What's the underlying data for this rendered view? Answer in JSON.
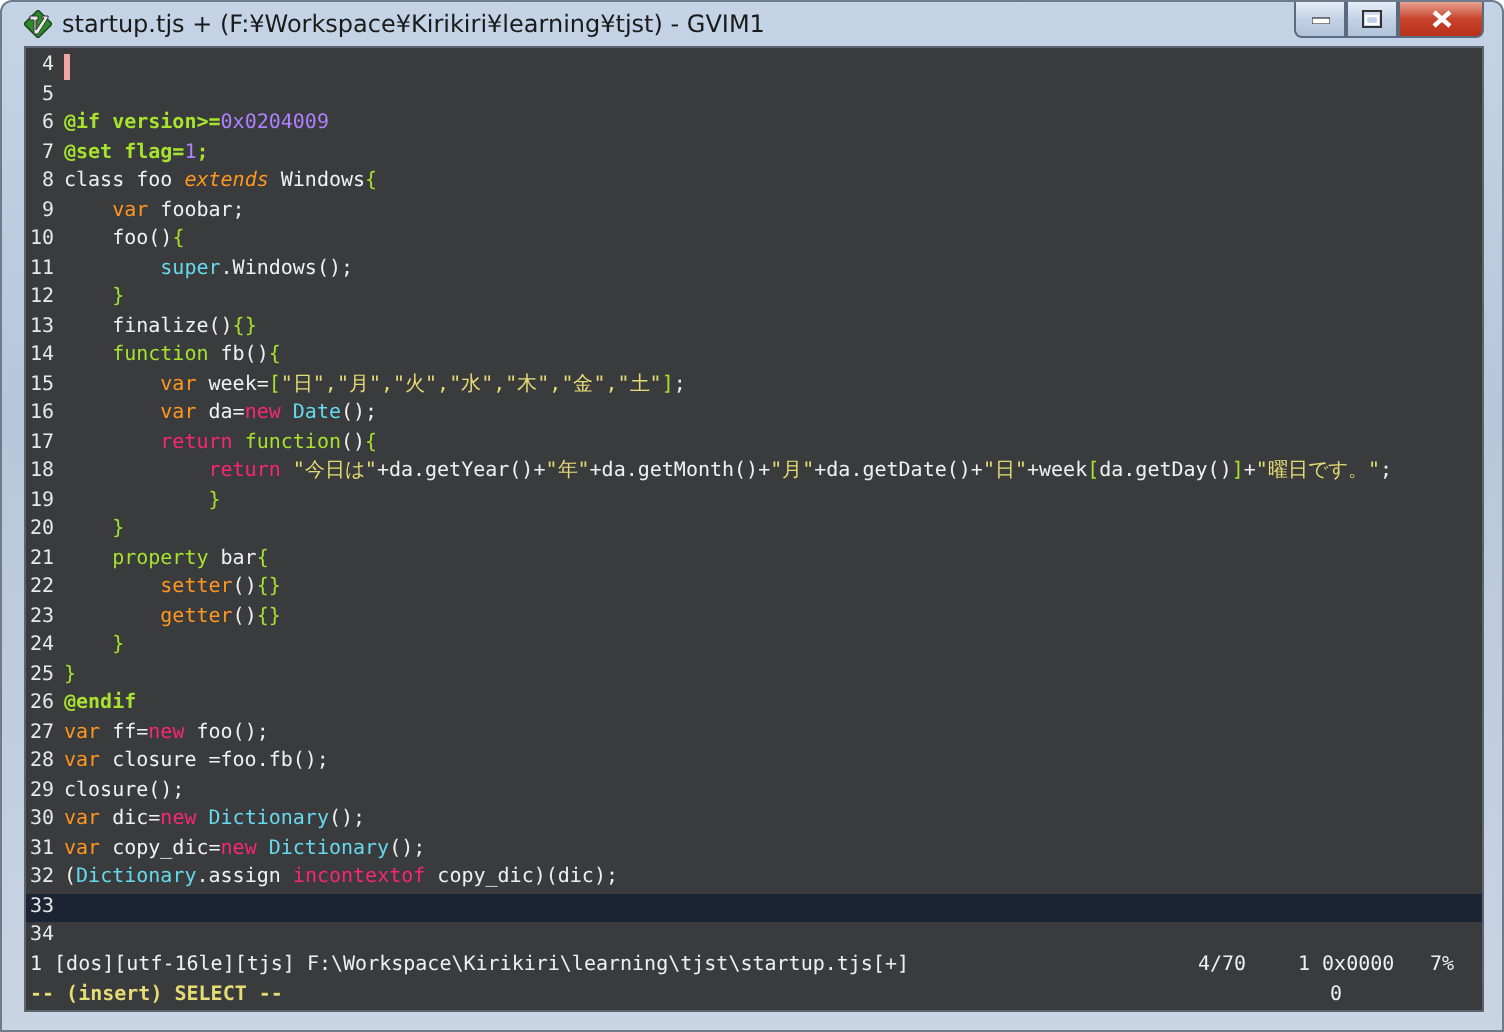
{
  "window": {
    "title": "startup.tjs + (F:¥Workspace¥Kirikiri¥learning¥tjst) - GVIM1"
  },
  "lines": [
    {
      "number": "4",
      "cursor": true,
      "highlighted": false
    },
    {
      "number": "5",
      "cursor": false,
      "highlighted": false
    },
    {
      "number": "6",
      "cursor": false,
      "highlighted": false,
      "segments": [
        {
          "text": "@if version>=",
          "kind": "directive"
        },
        {
          "text": "0x0204009",
          "kind": "number"
        }
      ]
    },
    {
      "number": "7",
      "cursor": false,
      "highlighted": false,
      "segments": [
        {
          "text": "@set flag=",
          "kind": "directive"
        },
        {
          "text": "1",
          "kind": "number"
        },
        {
          "text": ";",
          "kind": "directive"
        }
      ]
    },
    {
      "number": "8",
      "cursor": false,
      "highlighted": false,
      "segments": [
        {
          "text": "class foo ",
          "kind": "plain"
        },
        {
          "text": "extends",
          "kind": "modifier"
        },
        {
          "text": " Windows",
          "kind": "plain"
        },
        {
          "text": "{",
          "kind": "brace"
        }
      ]
    },
    {
      "number": "9",
      "cursor": false,
      "highlighted": false,
      "segments": [
        {
          "text": "    var",
          "kind": "keyword"
        },
        {
          "text": " foobar;",
          "kind": "plain"
        }
      ]
    },
    {
      "number": "10",
      "cursor": false,
      "highlighted": false,
      "segments": [
        {
          "text": "    foo()",
          "kind": "plain"
        },
        {
          "text": "{",
          "kind": "brace"
        }
      ]
    },
    {
      "number": "11",
      "cursor": false,
      "highlighted": false,
      "segments": [
        {
          "text": "        super",
          "kind": "type"
        },
        {
          "text": ".Windows();",
          "kind": "plain"
        }
      ]
    },
    {
      "number": "12",
      "cursor": false,
      "highlighted": false,
      "segments": [
        {
          "text": "    }",
          "kind": "brace"
        }
      ]
    },
    {
      "number": "13",
      "cursor": false,
      "highlighted": false,
      "segments": [
        {
          "text": "    finalize()",
          "kind": "plain"
        },
        {
          "text": "{}",
          "kind": "brace"
        }
      ]
    },
    {
      "number": "14",
      "cursor": false,
      "highlighted": false,
      "segments": [
        {
          "text": "    function",
          "kind": "declaration"
        },
        {
          "text": " fb()",
          "kind": "plain"
        },
        {
          "text": "{",
          "kind": "brace"
        }
      ]
    },
    {
      "number": "15",
      "cursor": false,
      "highlighted": false,
      "segments": [
        {
          "text": "        var",
          "kind": "keyword"
        },
        {
          "text": " week=",
          "kind": "plain"
        },
        {
          "text": "[",
          "kind": "brace"
        },
        {
          "text": "\"日\",\"月\",\"火\",\"水\",\"木\",\"金\",\"土\"",
          "kind": "string"
        },
        {
          "text": "]",
          "kind": "brace"
        },
        {
          "text": ";",
          "kind": "plain"
        }
      ]
    },
    {
      "number": "16",
      "cursor": false,
      "highlighted": false,
      "segments": [
        {
          "text": "        var",
          "kind": "keyword"
        },
        {
          "text": " da=",
          "kind": "plain"
        },
        {
          "text": "new",
          "kind": "operator"
        },
        {
          "text": " Date",
          "kind": "type"
        },
        {
          "text": "();",
          "kind": "plain"
        }
      ]
    },
    {
      "number": "17",
      "cursor": false,
      "highlighted": false,
      "segments": [
        {
          "text": "        return",
          "kind": "operator"
        },
        {
          "text": " function",
          "kind": "declaration"
        },
        {
          "text": "()",
          "kind": "plain"
        },
        {
          "text": "{",
          "kind": "brace"
        }
      ]
    },
    {
      "number": "18",
      "cursor": false,
      "highlighted": false,
      "segments": [
        {
          "text": "            return",
          "kind": "operator"
        },
        {
          "text": " \"今日は\"",
          "kind": "string"
        },
        {
          "text": "+da.getYear()+",
          "kind": "plain"
        },
        {
          "text": "\"年\"",
          "kind": "string"
        },
        {
          "text": "+da.getMonth()+",
          "kind": "plain"
        },
        {
          "text": "\"月\"",
          "kind": "string"
        },
        {
          "text": "+da.getDate()+",
          "kind": "plain"
        },
        {
          "text": "\"日\"",
          "kind": "string"
        },
        {
          "text": "+week",
          "kind": "plain"
        },
        {
          "text": "[",
          "kind": "brace"
        },
        {
          "text": "da.getDay()",
          "kind": "plain"
        },
        {
          "text": "]",
          "kind": "brace"
        },
        {
          "text": "+",
          "kind": "plain"
        },
        {
          "text": "\"曜日です。\"",
          "kind": "string"
        },
        {
          "text": ";",
          "kind": "plain"
        }
      ]
    },
    {
      "number": "19",
      "cursor": false,
      "highlighted": false,
      "segments": [
        {
          "text": "            }",
          "kind": "brace"
        }
      ]
    },
    {
      "number": "20",
      "cursor": false,
      "highlighted": false,
      "segments": [
        {
          "text": "    }",
          "kind": "brace"
        }
      ]
    },
    {
      "number": "21",
      "cursor": false,
      "highlighted": false,
      "segments": [
        {
          "text": "    property",
          "kind": "declaration"
        },
        {
          "text": " bar",
          "kind": "plain"
        },
        {
          "text": "{",
          "kind": "brace"
        }
      ]
    },
    {
      "number": "22",
      "cursor": false,
      "highlighted": false,
      "segments": [
        {
          "text": "        setter",
          "kind": "keyword"
        },
        {
          "text": "()",
          "kind": "plain"
        },
        {
          "text": "{}",
          "kind": "brace"
        }
      ]
    },
    {
      "number": "23",
      "cursor": false,
      "highlighted": false,
      "segments": [
        {
          "text": "        getter",
          "kind": "keyword"
        },
        {
          "text": "()",
          "kind": "plain"
        },
        {
          "text": "{}",
          "kind": "brace"
        }
      ]
    },
    {
      "number": "24",
      "cursor": false,
      "highlighted": false,
      "segments": [
        {
          "text": "    }",
          "kind": "brace"
        }
      ]
    },
    {
      "number": "25",
      "cursor": false,
      "highlighted": false,
      "segments": [
        {
          "text": "}",
          "kind": "brace"
        }
      ]
    },
    {
      "number": "26",
      "cursor": false,
      "highlighted": false,
      "segments": [
        {
          "text": "@endif",
          "kind": "directive"
        }
      ]
    },
    {
      "number": "27",
      "cursor": false,
      "highlighted": false,
      "segments": [
        {
          "text": "var",
          "kind": "keyword"
        },
        {
          "text": " ff=",
          "kind": "plain"
        },
        {
          "text": "new",
          "kind": "operator"
        },
        {
          "text": " foo();",
          "kind": "plain"
        }
      ]
    },
    {
      "number": "28",
      "cursor": false,
      "highlighted": false,
      "segments": [
        {
          "text": "var",
          "kind": "keyword"
        },
        {
          "text": " closure =foo.fb();",
          "kind": "plain"
        }
      ]
    },
    {
      "number": "29",
      "cursor": false,
      "highlighted": false,
      "segments": [
        {
          "text": "closure();",
          "kind": "plain"
        }
      ]
    },
    {
      "number": "30",
      "cursor": false,
      "highlighted": false,
      "segments": [
        {
          "text": "var",
          "kind": "keyword"
        },
        {
          "text": " dic=",
          "kind": "plain"
        },
        {
          "text": "new",
          "kind": "operator"
        },
        {
          "text": " Dictionary",
          "kind": "type"
        },
        {
          "text": "();",
          "kind": "plain"
        }
      ]
    },
    {
      "number": "31",
      "cursor": false,
      "highlighted": false,
      "segments": [
        {
          "text": "var",
          "kind": "keyword"
        },
        {
          "text": " copy_dic=",
          "kind": "plain"
        },
        {
          "text": "new",
          "kind": "operator"
        },
        {
          "text": " Dictionary",
          "kind": "type"
        },
        {
          "text": "();",
          "kind": "plain"
        }
      ]
    },
    {
      "number": "32",
      "cursor": false,
      "highlighted": false,
      "segments": [
        {
          "text": "(",
          "kind": "plain"
        },
        {
          "text": "Dictionary",
          "kind": "type"
        },
        {
          "text": ".assign ",
          "kind": "plain"
        },
        {
          "text": "incontextof",
          "kind": "operator"
        },
        {
          "text": " copy_dic)(dic);",
          "kind": "plain"
        }
      ]
    },
    {
      "number": "33",
      "cursor": false,
      "highlighted": true
    },
    {
      "number": "34",
      "cursor": false,
      "highlighted": false
    }
  ],
  "status_line": {
    "file": "1 [dos][utf-16le][tjs] F:\\Workspace\\Kirikiri\\learning\\tjst\\startup.tjs[+]",
    "position": "4/70",
    "column": "1 0x0000",
    "percent": "7%"
  },
  "mode_line": {
    "mode": "-- (insert) SELECT --",
    "count": "0"
  }
}
